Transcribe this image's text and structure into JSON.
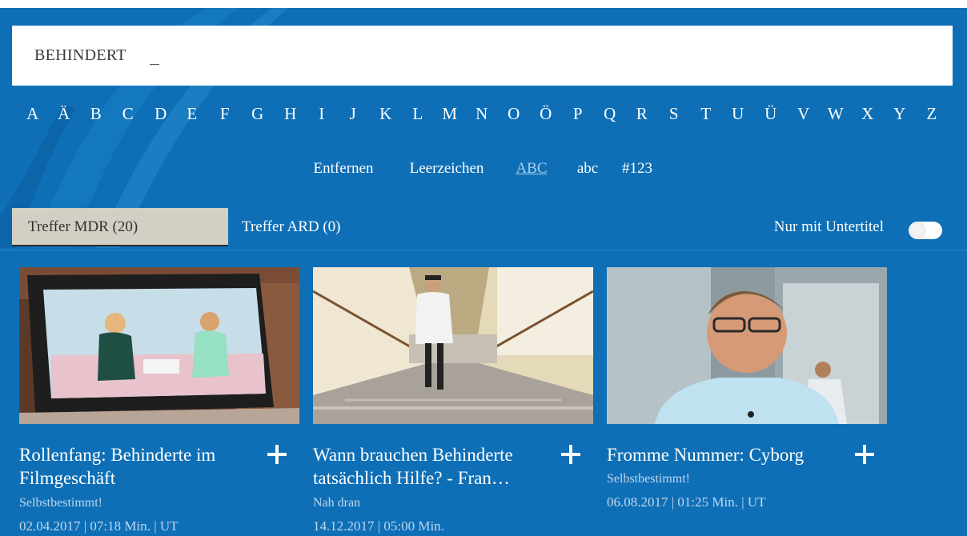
{
  "search": {
    "query": "BEHINDERT"
  },
  "keyboard": {
    "letters": [
      "A",
      "Ä",
      "B",
      "C",
      "D",
      "E",
      "F",
      "G",
      "H",
      "I",
      "J",
      "K",
      "L",
      "M",
      "N",
      "O",
      "Ö",
      "P",
      "Q",
      "R",
      "S",
      "T",
      "U",
      "Ü",
      "V",
      "W",
      "X",
      "Y",
      "Z"
    ],
    "controls": [
      "Entfernen",
      "Leerzeichen",
      "ABC",
      "abc",
      "#123"
    ],
    "active_control": "ABC"
  },
  "tabs": {
    "mdr": "Treffer MDR (20)",
    "ard": "Treffer ARD (0)",
    "subtitle_filter": "Nur mit Untertitel",
    "subtitle_toggle_on": false
  },
  "results": [
    {
      "title": "Rollenfang: Behinderte im Filmgeschäft",
      "show": "Selbstbestimmt!",
      "meta": "02.04.2017 | 07:18 Min. | UT"
    },
    {
      "title": "Wann brauchen Behinderte tatsächlich Hilfe? - Fran…",
      "show": "Nah dran",
      "meta": "14.12.2017 | 05:00 Min."
    },
    {
      "title": "Fromme Nummer: Cyborg",
      "show": "Selbstbestimmt!",
      "meta": "06.08.2017 | 01:25 Min. | UT"
    }
  ],
  "colors": {
    "background": "#0f6fb6",
    "active_tab": "#d3cfc4",
    "meta_text": "#bcd7ee"
  }
}
